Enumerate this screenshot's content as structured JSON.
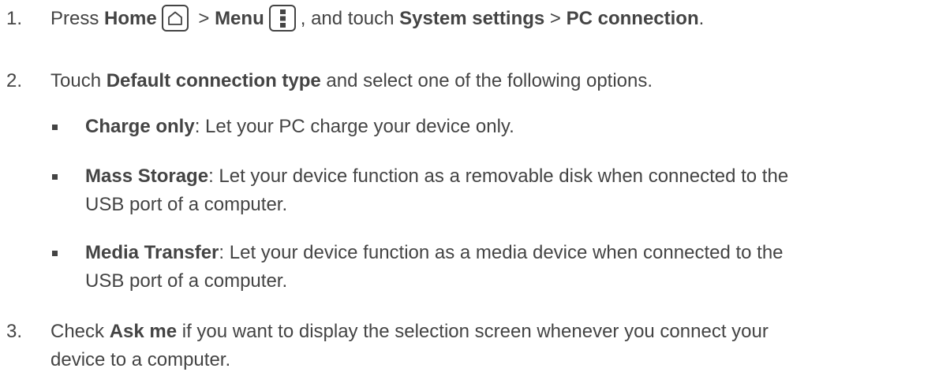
{
  "steps": [
    {
      "number": "1.",
      "press": "Press ",
      "home_label": "Home",
      "sep1": " > ",
      "menu_label": "Menu",
      "mid": ", and touch ",
      "system_settings": "System settings",
      "sep2": " > ",
      "pc_connection": "PC connection",
      "end": "."
    },
    {
      "number": "2.",
      "touch": "Touch ",
      "default_connection_type": "Default connection type",
      "rest": " and select one of the following options."
    },
    {
      "number": "3.",
      "check": "Check ",
      "ask_me": "Ask me",
      "rest_line1": " if you want to display the selection screen whenever you connect your",
      "rest_line2": "device to a computer."
    }
  ],
  "options": [
    {
      "title": "Charge only",
      "desc_line1": ": Let your PC charge your device only.",
      "desc_line2": ""
    },
    {
      "title": "Mass Storage",
      "desc_line1": ": Let your device function as a removable disk when connected to the",
      "desc_line2": "USB port of a computer."
    },
    {
      "title": "Media Transfer",
      "desc_line1": ": Let your device function as a media device when connected to the",
      "desc_line2": "USB port of a computer."
    }
  ],
  "icons": {
    "home": "home-icon",
    "menu": "menu-icon"
  },
  "colors": {
    "text": "#444444",
    "background": "#ffffff"
  }
}
